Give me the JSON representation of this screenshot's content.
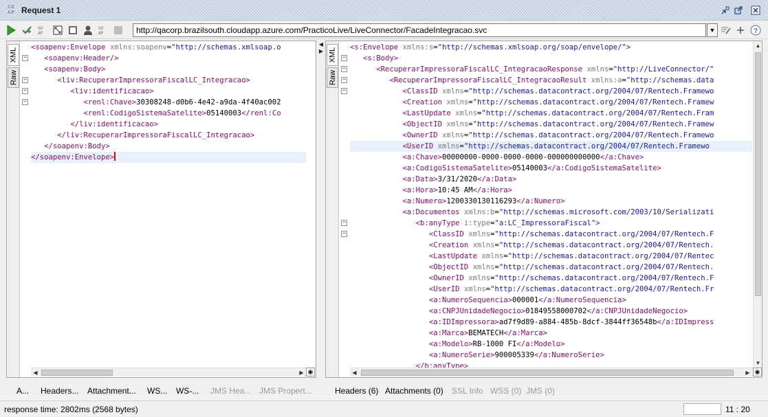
{
  "window": {
    "title": "Request 1",
    "badge_top": "SO",
    "badge_bottom": "AP"
  },
  "window_controls": [
    "minimize-icon",
    "restore-icon",
    "close-icon"
  ],
  "toolbar": {
    "endpoint_url": "http://qacorp.brazilsouth.cloudapp.azure.com/PracticoLive/LiveConnector/FacadeIntegracao.svc",
    "icons": [
      "run-icon",
      "add-assertion-icon",
      "ws-security-icon",
      "fullscreen-icon",
      "stop-icon",
      "user-icon",
      "ws-addressing-icon",
      "disabled-icon"
    ],
    "right_icons": [
      "edit-endpoint-icon",
      "add-endpoint-icon",
      "help-icon"
    ]
  },
  "request_panel": {
    "tabs": [
      "XML",
      "Raw"
    ],
    "active_tab": "XML",
    "caret_line": 10,
    "highlight_line": 10,
    "fold_lines": [
      1,
      3,
      4,
      5
    ],
    "lines": [
      [
        [
          "tg",
          "<soapenv:Envelope "
        ],
        [
          "at",
          "xmlns:soapenv"
        ],
        [
          "tx",
          "="
        ],
        [
          "vl",
          "\"http://schemas.xmlsoap.o"
        ]
      ],
      [
        [
          "tx",
          "   "
        ],
        [
          "tg",
          "<soapenv:Header/>"
        ]
      ],
      [
        [
          "tx",
          "   "
        ],
        [
          "tg",
          "<soapenv:Body>"
        ]
      ],
      [
        [
          "tx",
          "      "
        ],
        [
          "tg",
          "<liv:RecuperarImpressoraFiscalLC_Integracao>"
        ]
      ],
      [
        [
          "tx",
          "         "
        ],
        [
          "tg",
          "<liv:identificacao>"
        ]
      ],
      [
        [
          "tx",
          "            "
        ],
        [
          "tg",
          "<renl:Chave>"
        ],
        [
          "tx",
          "30308248-d0b6-4e42-a9da-4f40ac002"
        ]
      ],
      [
        [
          "tx",
          "            "
        ],
        [
          "tg",
          "<renl:CodigoSistemaSatelite>"
        ],
        [
          "tx",
          "05140003"
        ],
        [
          "tg",
          "</renl:Co"
        ]
      ],
      [
        [
          "tx",
          "         "
        ],
        [
          "tg",
          "</liv:identificacao>"
        ]
      ],
      [
        [
          "tx",
          "      "
        ],
        [
          "tg",
          "</liv:RecuperarImpressoraFiscalLC_Integracao>"
        ]
      ],
      [
        [
          "tx",
          "   "
        ],
        [
          "tg",
          "</soapenv:Body>"
        ]
      ],
      [
        [
          "tg",
          "</soapenv:Envelope>"
        ]
      ]
    ],
    "bottom_tabs": [
      {
        "label": "A...",
        "enabled": true
      },
      {
        "label": "Headers...",
        "enabled": true
      },
      {
        "label": "Attachment...",
        "enabled": true
      },
      {
        "label": "WS...",
        "enabled": true
      },
      {
        "label": "WS-...",
        "enabled": true
      },
      {
        "label": "JMS Hea...",
        "enabled": false
      },
      {
        "label": "JMS Propert...",
        "enabled": false
      }
    ]
  },
  "response_panel": {
    "tabs": [
      "XML",
      "Raw"
    ],
    "active_tab": "XML",
    "highlight_line": 9,
    "fold_lines": [
      1,
      2,
      3,
      4,
      16,
      17
    ],
    "lines": [
      [
        [
          "tg",
          "<s:Envelope "
        ],
        [
          "at",
          "xmlns:s"
        ],
        [
          "tx",
          "="
        ],
        [
          "vl",
          "\"http://schemas.xmlsoap.org/soap/envelope/\""
        ],
        [
          "tg",
          ">"
        ]
      ],
      [
        [
          "tx",
          "   "
        ],
        [
          "tg",
          "<s:Body>"
        ]
      ],
      [
        [
          "tx",
          "      "
        ],
        [
          "tg",
          "<RecuperarImpressoraFiscalLC_IntegracaoResponse "
        ],
        [
          "at",
          "xmlns"
        ],
        [
          "tx",
          "="
        ],
        [
          "vl",
          "\"http://LiveConnector/\""
        ]
      ],
      [
        [
          "tx",
          "         "
        ],
        [
          "tg",
          "<RecuperarImpressoraFiscalLC_IntegracaoResult "
        ],
        [
          "at",
          "xmlns:a"
        ],
        [
          "tx",
          "="
        ],
        [
          "vl",
          "\"http://schemas.data"
        ]
      ],
      [
        [
          "tx",
          "            "
        ],
        [
          "tg",
          "<ClassID "
        ],
        [
          "at",
          "xmlns"
        ],
        [
          "tx",
          "="
        ],
        [
          "vl",
          "\"http://schemas.datacontract.org/2004/07/Rentech.Framewo"
        ]
      ],
      [
        [
          "tx",
          "            "
        ],
        [
          "tg",
          "<Creation "
        ],
        [
          "at",
          "xmlns"
        ],
        [
          "tx",
          "="
        ],
        [
          "vl",
          "\"http://schemas.datacontract.org/2004/07/Rentech.Framew"
        ]
      ],
      [
        [
          "tx",
          "            "
        ],
        [
          "tg",
          "<LastUpdate "
        ],
        [
          "at",
          "xmlns"
        ],
        [
          "tx",
          "="
        ],
        [
          "vl",
          "\"http://schemas.datacontract.org/2004/07/Rentech.Fram"
        ]
      ],
      [
        [
          "tx",
          "            "
        ],
        [
          "tg",
          "<ObjectID "
        ],
        [
          "at",
          "xmlns"
        ],
        [
          "tx",
          "="
        ],
        [
          "vl",
          "\"http://schemas.datacontract.org/2004/07/Rentech.Framew"
        ]
      ],
      [
        [
          "tx",
          "            "
        ],
        [
          "tg",
          "<OwnerID "
        ],
        [
          "at",
          "xmlns"
        ],
        [
          "tx",
          "="
        ],
        [
          "vl",
          "\"http://schemas.datacontract.org/2004/07/Rentech.Framewo"
        ]
      ],
      [
        [
          "tx",
          "            "
        ],
        [
          "tg",
          "<UserID "
        ],
        [
          "at",
          "xmlns"
        ],
        [
          "tx",
          "="
        ],
        [
          "vl",
          "\"http://schemas.datacontract.org/2004/07/Rentech.Framewo"
        ]
      ],
      [
        [
          "tx",
          "            "
        ],
        [
          "tg",
          "<a:Chave>"
        ],
        [
          "tx",
          "00000000-0000-0000-0000-000000000000"
        ],
        [
          "tg",
          "</a:Chave>"
        ]
      ],
      [
        [
          "tx",
          "            "
        ],
        [
          "tg",
          "<a:CodigoSistemaSatelite>"
        ],
        [
          "tx",
          "05140003"
        ],
        [
          "tg",
          "</a:CodigoSistemaSatelite>"
        ]
      ],
      [
        [
          "tx",
          "            "
        ],
        [
          "tg",
          "<a:Data>"
        ],
        [
          "tx",
          "3/31/2020"
        ],
        [
          "tg",
          "</a:Data>"
        ]
      ],
      [
        [
          "tx",
          "            "
        ],
        [
          "tg",
          "<a:Hora>"
        ],
        [
          "tx",
          "10:45 AM"
        ],
        [
          "tg",
          "</a:Hora>"
        ]
      ],
      [
        [
          "tx",
          "            "
        ],
        [
          "tg",
          "<a:Numero>"
        ],
        [
          "tx",
          "1200330130116293"
        ],
        [
          "tg",
          "</a:Numero>"
        ]
      ],
      [
        [
          "tx",
          "            "
        ],
        [
          "tg",
          "<a:Documentos "
        ],
        [
          "at",
          "xmlns:b"
        ],
        [
          "tx",
          "="
        ],
        [
          "vl",
          "\"http://schemas.microsoft.com/2003/10/Serializati"
        ]
      ],
      [
        [
          "tx",
          "               "
        ],
        [
          "tg",
          "<b:anyType "
        ],
        [
          "at",
          "i:type"
        ],
        [
          "tx",
          "="
        ],
        [
          "vl",
          "\"a:LC_ImpressoraFiscal\""
        ],
        [
          "tg",
          ">"
        ]
      ],
      [
        [
          "tx",
          "                  "
        ],
        [
          "tg",
          "<ClassID "
        ],
        [
          "at",
          "xmlns"
        ],
        [
          "tx",
          "="
        ],
        [
          "vl",
          "\"http://schemas.datacontract.org/2004/07/Rentech.F"
        ]
      ],
      [
        [
          "tx",
          "                  "
        ],
        [
          "tg",
          "<Creation "
        ],
        [
          "at",
          "xmlns"
        ],
        [
          "tx",
          "="
        ],
        [
          "vl",
          "\"http://schemas.datacontract.org/2004/07/Rentech."
        ]
      ],
      [
        [
          "tx",
          "                  "
        ],
        [
          "tg",
          "<LastUpdate "
        ],
        [
          "at",
          "xmlns"
        ],
        [
          "tx",
          "="
        ],
        [
          "vl",
          "\"http://schemas.datacontract.org/2004/07/Rentec"
        ]
      ],
      [
        [
          "tx",
          "                  "
        ],
        [
          "tg",
          "<ObjectID "
        ],
        [
          "at",
          "xmlns"
        ],
        [
          "tx",
          "="
        ],
        [
          "vl",
          "\"http://schemas.datacontract.org/2004/07/Rentech."
        ]
      ],
      [
        [
          "tx",
          "                  "
        ],
        [
          "tg",
          "<OwnerID "
        ],
        [
          "at",
          "xmlns"
        ],
        [
          "tx",
          "="
        ],
        [
          "vl",
          "\"http://schemas.datacontract.org/2004/07/Rentech.F"
        ]
      ],
      [
        [
          "tx",
          "                  "
        ],
        [
          "tg",
          "<UserID "
        ],
        [
          "at",
          "xmlns"
        ],
        [
          "tx",
          "="
        ],
        [
          "vl",
          "\"http://schemas.datacontract.org/2004/07/Rentech.Fr"
        ]
      ],
      [
        [
          "tx",
          "                  "
        ],
        [
          "tg",
          "<a:NumeroSequencia>"
        ],
        [
          "tx",
          "000001"
        ],
        [
          "tg",
          "</a:NumeroSequencia>"
        ]
      ],
      [
        [
          "tx",
          "                  "
        ],
        [
          "tg",
          "<a:CNPJUnidadeNegocio>"
        ],
        [
          "tx",
          "01849558000702"
        ],
        [
          "tg",
          "</a:CNPJUnidadeNegocio>"
        ]
      ],
      [
        [
          "tx",
          "                  "
        ],
        [
          "tg",
          "<a:IDImpressora>"
        ],
        [
          "tx",
          "ad7f9d89-a884-485b-8dcf-3844ff36548b"
        ],
        [
          "tg",
          "</a:IDImpress"
        ]
      ],
      [
        [
          "tx",
          "                  "
        ],
        [
          "tg",
          "<a:Marca>"
        ],
        [
          "tx",
          "BEMATECH"
        ],
        [
          "tg",
          "</a:Marca>"
        ]
      ],
      [
        [
          "tx",
          "                  "
        ],
        [
          "tg",
          "<a:Modelo>"
        ],
        [
          "tx",
          "RB-1000 FI"
        ],
        [
          "tg",
          "</a:Modelo>"
        ]
      ],
      [
        [
          "tx",
          "                  "
        ],
        [
          "tg",
          "<a:NumeroSerie>"
        ],
        [
          "tx",
          "900005339"
        ],
        [
          "tg",
          "</a:NumeroSerie>"
        ]
      ],
      [
        [
          "tx",
          "               "
        ],
        [
          "tg",
          "</b:anyType>"
        ]
      ]
    ],
    "bottom_tabs": [
      {
        "label": "Headers (6)",
        "enabled": true
      },
      {
        "label": "Attachments (0)",
        "enabled": true
      },
      {
        "label": "SSL Info",
        "enabled": false
      },
      {
        "label": "WSS (0)",
        "enabled": false
      },
      {
        "label": "JMS (0)",
        "enabled": false
      }
    ]
  },
  "status": {
    "response_time": "response time: 2802ms (2568 bytes)",
    "cursor_position": "11 : 20"
  }
}
